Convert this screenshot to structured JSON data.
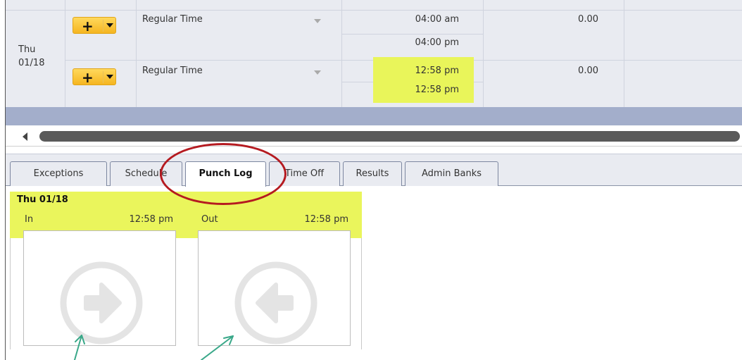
{
  "timesheet": {
    "day_name": "Thu",
    "day_date": "01/18",
    "rows": [
      {
        "pay_type": "Regular Time",
        "time_in": "04:00 am",
        "time_out": "04:00 pm",
        "hours": "0.00"
      },
      {
        "pay_type": "Regular Time",
        "time_in": "12:58 pm",
        "time_out": "12:58 pm",
        "hours": "0.00"
      }
    ]
  },
  "tabs": [
    "Exceptions",
    "Schedule",
    "Punch Log",
    "Time Off",
    "Results",
    "Admin Banks"
  ],
  "active_tab": "Punch Log",
  "punch_log": {
    "date": "Thu 01/18",
    "in_label": "In",
    "in_time": "12:58 pm",
    "out_label": "Out",
    "out_time": "12:58 pm"
  },
  "colors": {
    "highlight": "#e9f55a",
    "annotation_oval": "#b51a20",
    "annotation_arrow": "#3aa889",
    "button_gold": "#f5b521"
  },
  "icons": {
    "in_punch": "arrow-right-circle-icon",
    "out_punch": "arrow-left-circle-icon"
  }
}
